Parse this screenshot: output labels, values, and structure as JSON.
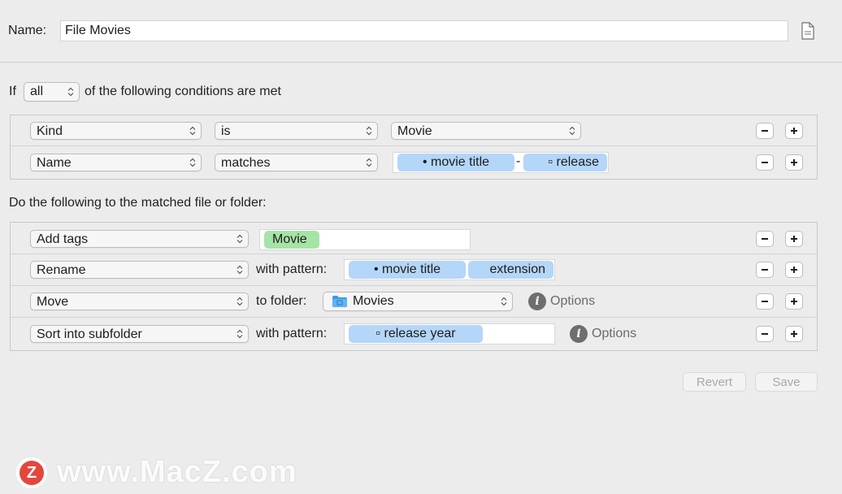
{
  "name": {
    "label": "Name:",
    "value": "File Movies",
    "doc_icon": "document-icon"
  },
  "condition_header": {
    "prefix": "If",
    "match_mode": "all",
    "suffix": "of the following conditions are met"
  },
  "conditions": [
    {
      "attribute": "Kind",
      "operator": "is",
      "value": "Movie"
    },
    {
      "attribute": "Name",
      "operator": "matches",
      "tokens": [
        "• movie title",
        "▫ release"
      ],
      "separator": "-"
    }
  ],
  "actions_header": "Do the following to the matched file or folder:",
  "actions": [
    {
      "action": "Add tags",
      "tags": [
        "Movie"
      ]
    },
    {
      "action": "Rename",
      "connector": "with pattern:",
      "tokens": [
        "• movie title",
        "extension"
      ]
    },
    {
      "action": "Move",
      "connector": "to folder:",
      "folder": "Movies",
      "options": "Options"
    },
    {
      "action": "Sort into subfolder",
      "connector": "with pattern:",
      "tokens": [
        "▫ release year"
      ],
      "options": "Options"
    }
  ],
  "buttons": {
    "minus": "−",
    "plus": "+",
    "revert": "Revert",
    "save": "Save",
    "info": "i"
  },
  "watermark": {
    "text": "www.MacZ.com",
    "logo_letter": "Z"
  },
  "colors": {
    "token_blue": "#b4d6f8",
    "tag_green": "#a6e3a6",
    "background": "#ececec",
    "logo_red": "#e4463c"
  }
}
